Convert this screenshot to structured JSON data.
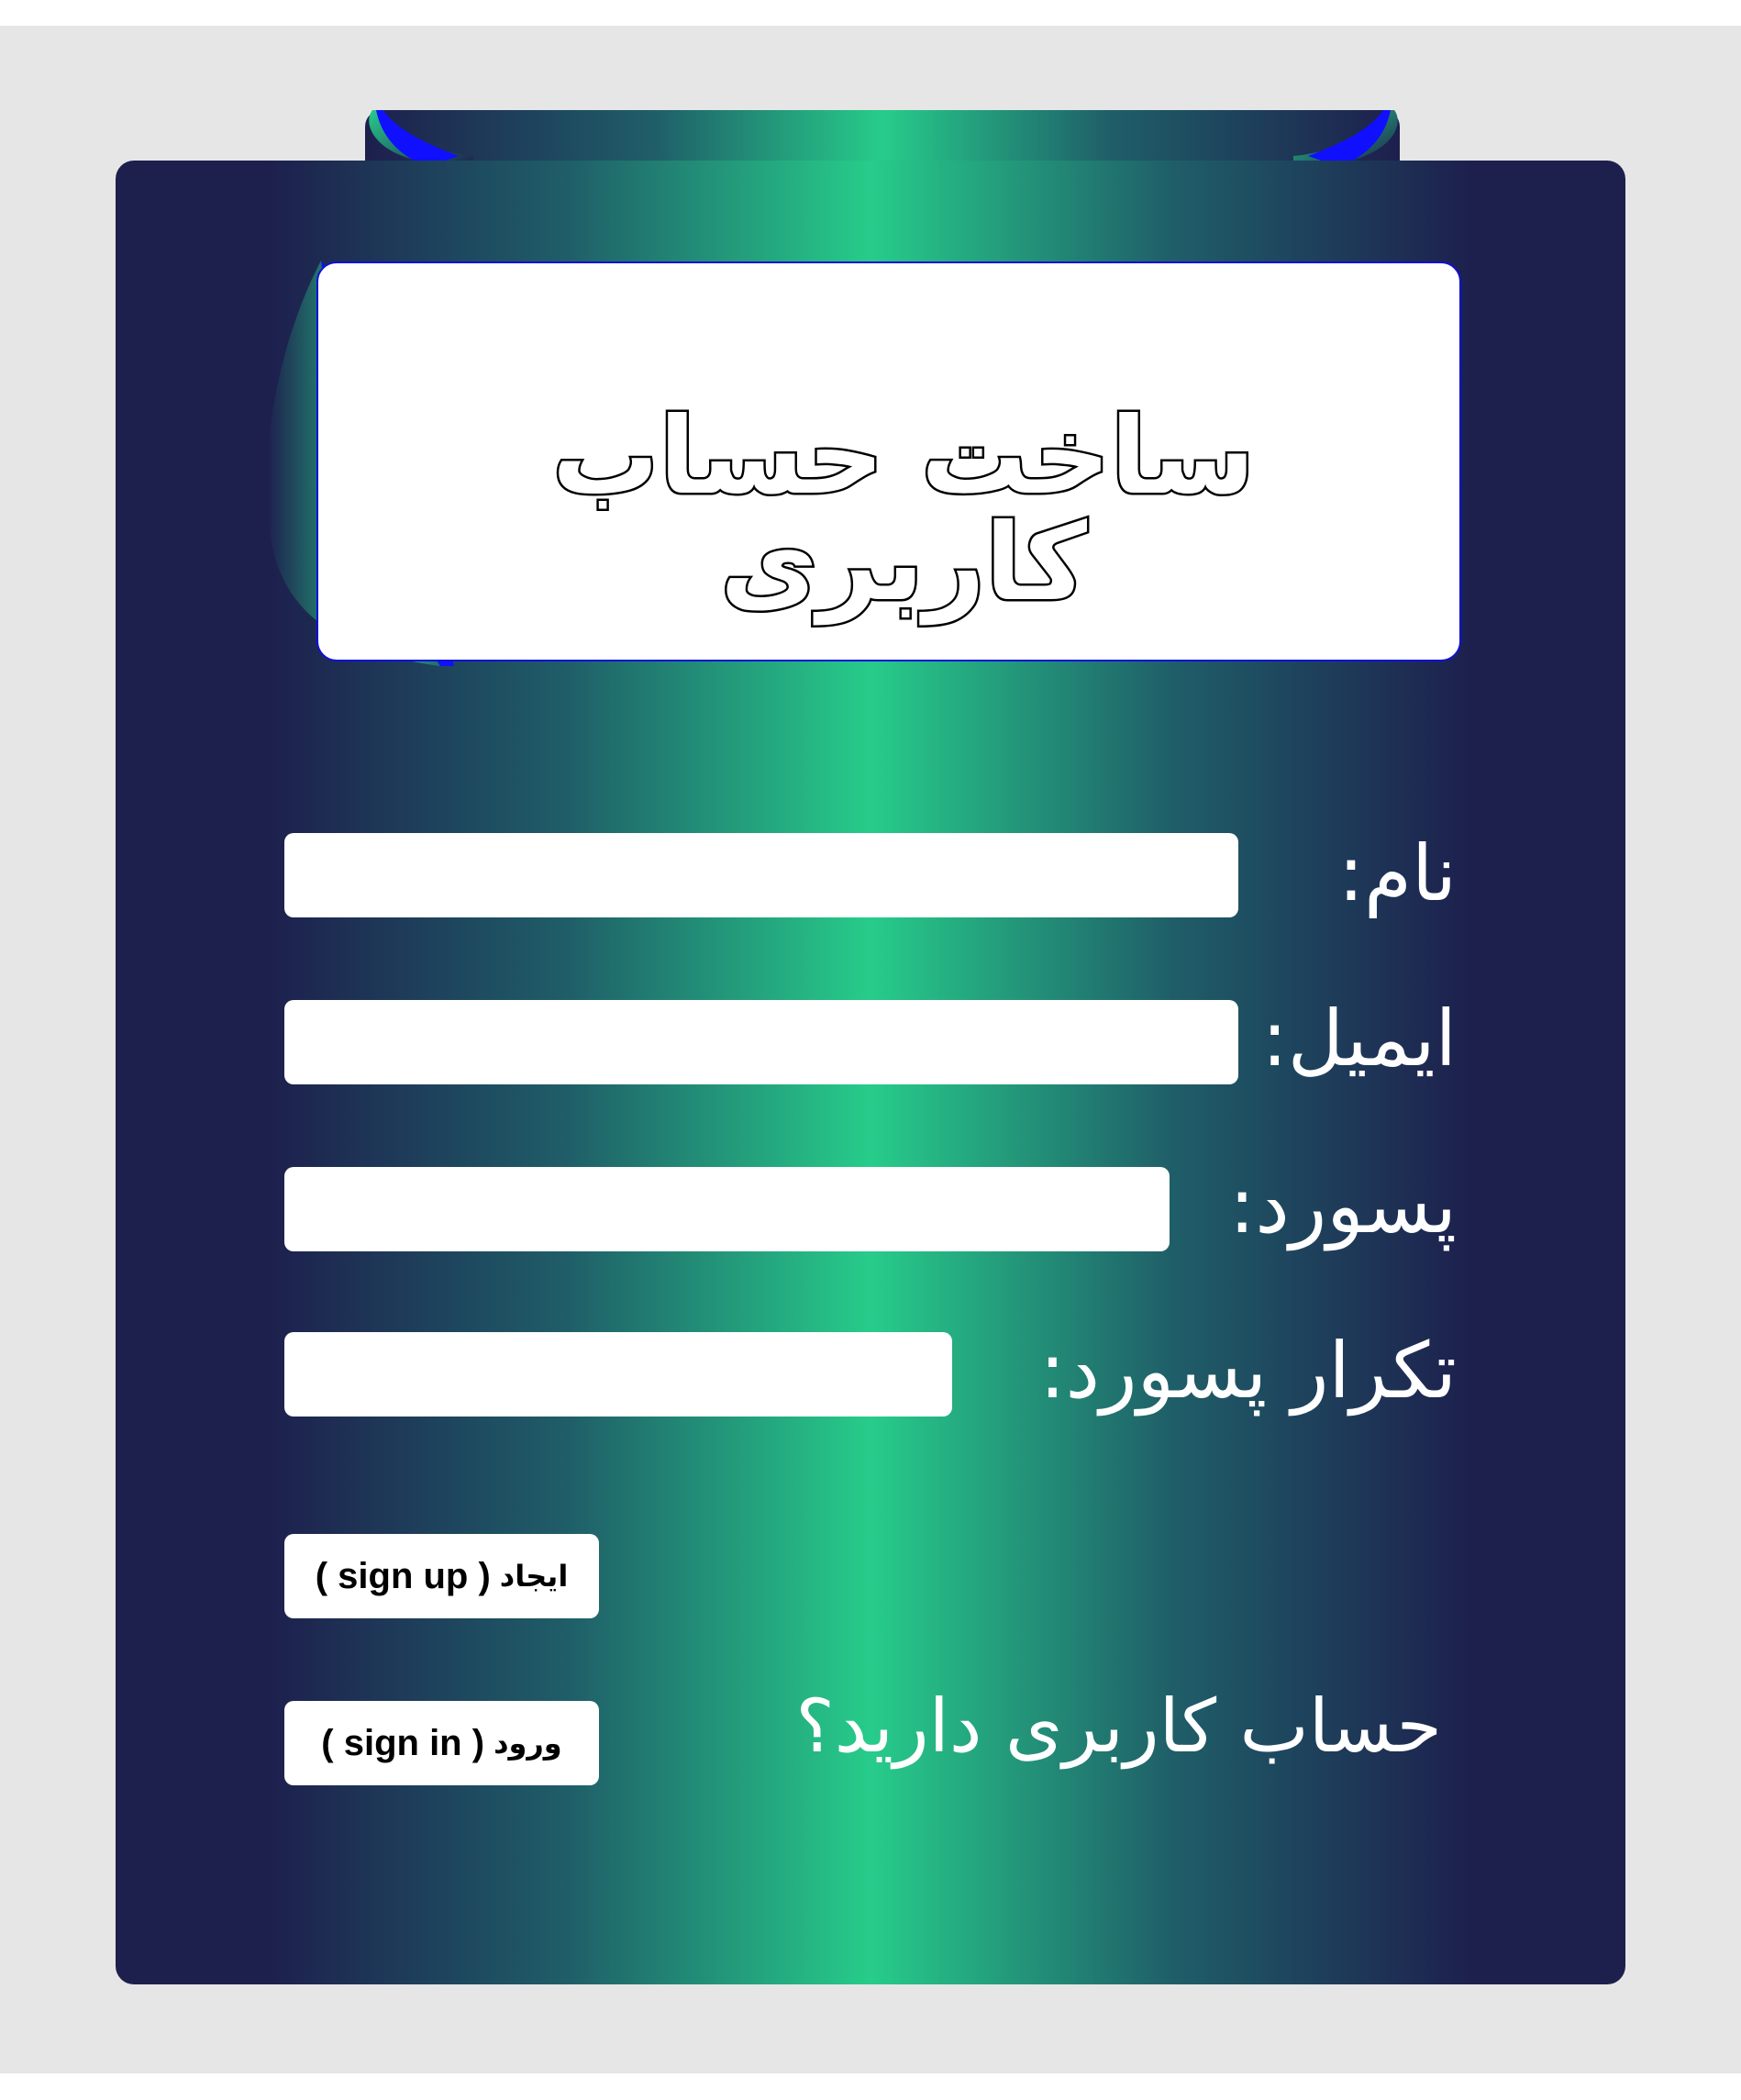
{
  "form": {
    "title": "ساخت حساب کاربری",
    "fields": [
      {
        "label": "نام:",
        "value": ""
      },
      {
        "label": "ایمیل:",
        "value": ""
      },
      {
        "label": "پسورد:",
        "value": ""
      },
      {
        "label": "تکرار پسورد:",
        "value": ""
      }
    ],
    "signup": {
      "label_fa": "ایجاد",
      "label_en": "( sign up )"
    },
    "signin_question": "حساب کاربری دارید؟",
    "signin": {
      "label_fa": "ورود",
      "label_en": "( sign in )"
    }
  },
  "colors": {
    "background": "#e6e6e6",
    "card_dark": "#1d1f4d",
    "card_light": "#27cc8a",
    "accent_blue": "#1010d8"
  }
}
